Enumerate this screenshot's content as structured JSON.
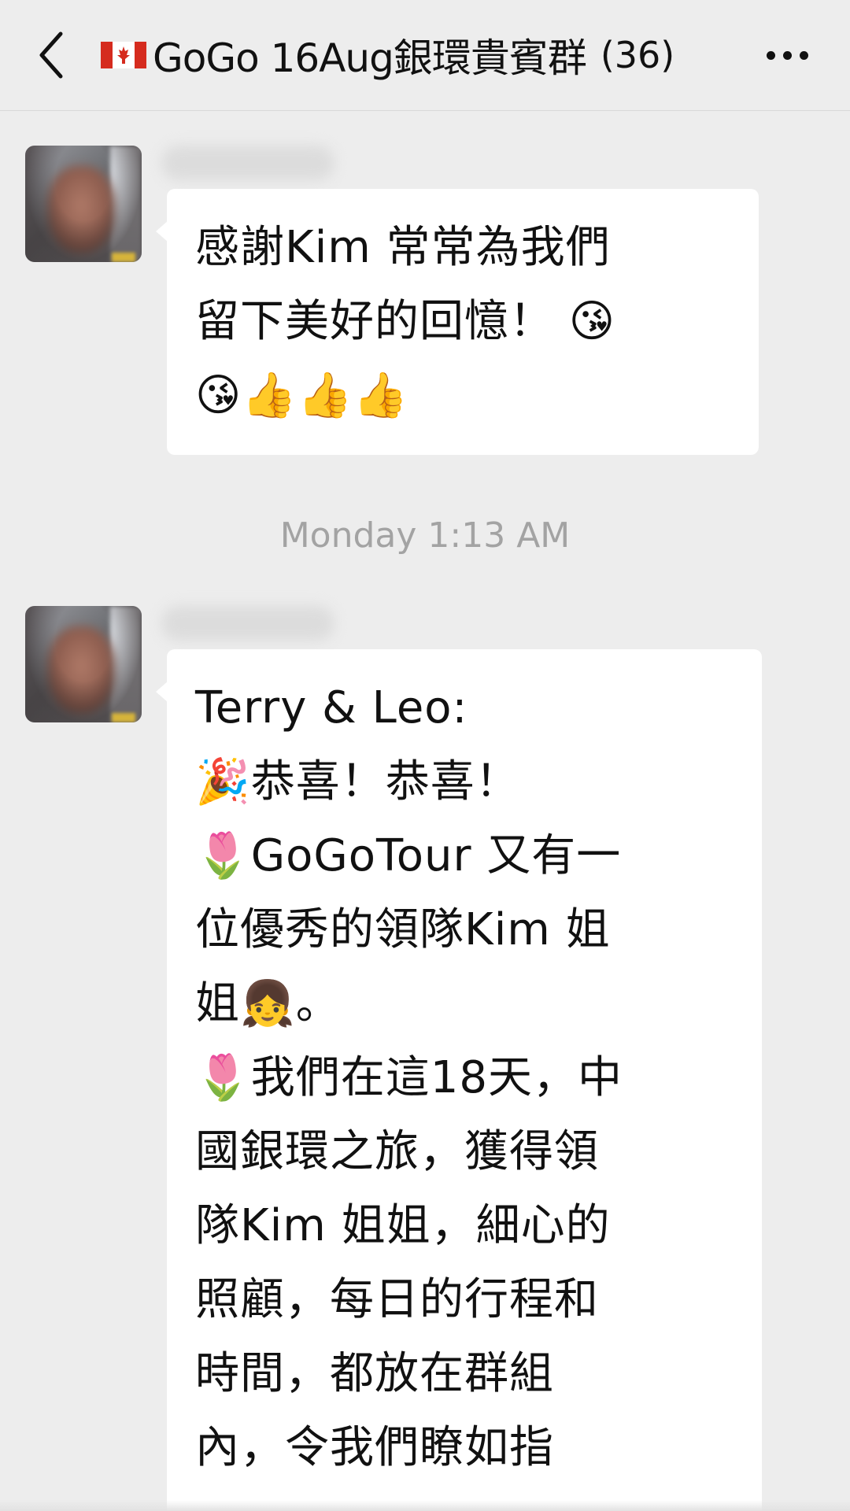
{
  "header": {
    "back_icon": "chevron-left-icon",
    "flag_icon": "canada-flag-icon",
    "title": "GoGo 16Aug銀環貴賓群",
    "member_count": "(36)",
    "more_icon": "more-horizontal-icon"
  },
  "messages": [
    {
      "lines": [
        "感謝Kim 常常為我們",
        "留下美好的回憶！ 😘",
        "😘👍👍👍"
      ]
    },
    {
      "lines": [
        "Terry & Leo:",
        "🎉恭喜！恭喜！",
        "🌷GoGoTour 又有一",
        "位優秀的領隊Kim 姐",
        "姐👧。",
        "🌷我們在這18天，中",
        "國銀環之旅，獲得領",
        "隊Kim 姐姐，細心的",
        "照顧，每日的行程和",
        "時間，都放在群組",
        "內，令我們瞭如指"
      ]
    }
  ],
  "timestamp": "Monday 1:13 AM",
  "colors": {
    "background": "#ededed",
    "bubble": "#ffffff",
    "timestamp_text": "#a3a3a3"
  }
}
